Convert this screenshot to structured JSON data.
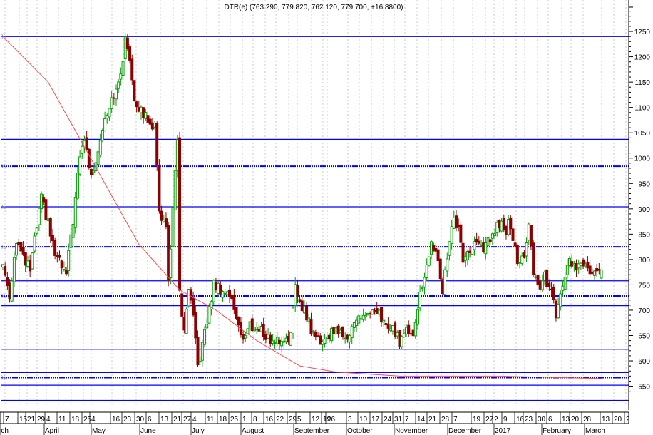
{
  "chart_data": {
    "type": "candlestick",
    "title": "DTR(e) (763.290, 779.820, 762.120, 779.700, +16.8800)",
    "ylim": [
      510,
      1312
    ],
    "y_ticks": [
      550,
      600,
      650,
      700,
      750,
      800,
      850,
      900,
      950,
      1000,
      1050,
      1100,
      1150,
      1200,
      1250
    ],
    "num_bars": 265,
    "close_anchors": [
      [
        0,
        790
      ],
      [
        3,
        730
      ],
      [
        6,
        840
      ],
      [
        9,
        800
      ],
      [
        12,
        780
      ],
      [
        17,
        920
      ],
      [
        20,
        870
      ],
      [
        23,
        810
      ],
      [
        28,
        770
      ],
      [
        31,
        880
      ],
      [
        34,
        1000
      ],
      [
        36,
        1040
      ],
      [
        39,
        960
      ],
      [
        42,
        1020
      ],
      [
        45,
        1080
      ],
      [
        48,
        1120
      ],
      [
        51,
        1140
      ],
      [
        54,
        1230
      ],
      [
        56,
        1200
      ],
      [
        58,
        1120
      ],
      [
        61,
        1090
      ],
      [
        64,
        1080
      ],
      [
        67,
        1060
      ],
      [
        69,
        900
      ],
      [
        72,
        860
      ],
      [
        73,
        760
      ],
      [
        75,
        900
      ],
      [
        77,
        1030
      ],
      [
        78,
        740
      ],
      [
        80,
        650
      ],
      [
        82,
        740
      ],
      [
        84,
        680
      ],
      [
        86,
        590
      ],
      [
        88,
        630
      ],
      [
        91,
        700
      ],
      [
        93,
        750
      ],
      [
        97,
        740
      ],
      [
        100,
        730
      ],
      [
        103,
        690
      ],
      [
        106,
        640
      ],
      [
        109,
        670
      ],
      [
        114,
        660
      ],
      [
        118,
        640
      ],
      [
        122,
        640
      ],
      [
        127,
        650
      ],
      [
        129,
        740
      ],
      [
        131,
        720
      ],
      [
        134,
        690
      ],
      [
        137,
        650
      ],
      [
        141,
        640
      ],
      [
        144,
        650
      ],
      [
        147,
        670
      ],
      [
        150,
        640
      ],
      [
        153,
        660
      ],
      [
        156,
        680
      ],
      [
        159,
        690
      ],
      [
        162,
        690
      ],
      [
        166,
        690
      ],
      [
        169,
        670
      ],
      [
        172,
        660
      ],
      [
        175,
        640
      ],
      [
        178,
        660
      ],
      [
        181,
        660
      ],
      [
        184,
        730
      ],
      [
        188,
        800
      ],
      [
        189,
        840
      ],
      [
        191,
        810
      ],
      [
        194,
        740
      ],
      [
        196,
        810
      ],
      [
        199,
        880
      ],
      [
        201,
        860
      ],
      [
        203,
        800
      ],
      [
        206,
        820
      ],
      [
        209,
        830
      ],
      [
        212,
        820
      ],
      [
        216,
        850
      ],
      [
        219,
        870
      ],
      [
        222,
        860
      ],
      [
        223,
        890
      ],
      [
        227,
        800
      ],
      [
        230,
        800
      ],
      [
        232,
        860
      ],
      [
        234,
        780
      ],
      [
        237,
        740
      ],
      [
        239,
        770
      ],
      [
        242,
        730
      ],
      [
        244,
        690
      ],
      [
        247,
        740
      ],
      [
        250,
        800
      ],
      [
        253,
        780
      ],
      [
        256,
        790
      ],
      [
        259,
        770
      ],
      [
        264,
        780
      ]
    ],
    "last_bar": {
      "open": 763.29,
      "high": 779.82,
      "low": 762.12,
      "close": 779.7
    },
    "moving_average": [
      [
        0,
        1240
      ],
      [
        20,
        1150
      ],
      [
        40,
        990
      ],
      [
        60,
        830
      ],
      [
        78,
        740
      ],
      [
        94,
        700
      ],
      [
        112,
        640
      ],
      [
        131,
        590
      ],
      [
        147,
        578
      ],
      [
        175,
        570
      ],
      [
        219,
        570
      ],
      [
        264,
        565
      ]
    ],
    "horizontal_lines": [
      {
        "price": 1240,
        "style": "solid",
        "marker": "%"
      },
      {
        "price": 1037,
        "style": "solid"
      },
      {
        "price": 984,
        "style": "dotted",
        "marker": "%"
      },
      {
        "price": 904,
        "style": "solid",
        "marker": "%"
      },
      {
        "price": 825,
        "style": "dotted",
        "marker": "%"
      },
      {
        "price": 758,
        "style": "solid"
      },
      {
        "price": 728,
        "style": "dotted",
        "marker": "%"
      },
      {
        "price": 709,
        "style": "solid"
      },
      {
        "price": 623,
        "style": "solid"
      },
      {
        "price": 577,
        "style": "solid"
      },
      {
        "price": 567,
        "style": "dotted",
        "marker": "%"
      },
      {
        "price": 552,
        "style": "solid"
      },
      {
        "price": 522,
        "style": "solid"
      }
    ],
    "x_tick_labels": [
      "7",
      "15",
      "21",
      "29",
      "4",
      "11",
      "18",
      "25",
      "4",
      "16",
      "23",
      "30",
      "6",
      "13",
      "21",
      "27",
      "4",
      "11",
      "18",
      "25",
      "1",
      "8",
      "16",
      "22",
      "29",
      "5",
      "12",
      "19",
      "26",
      "3",
      "10",
      "17",
      "24",
      "31",
      "7",
      "14",
      "21",
      "28",
      "7",
      "19",
      "27",
      "2",
      "9",
      "16",
      "23",
      "30",
      "6",
      "13",
      "20",
      "28",
      "13",
      "20",
      "2"
    ],
    "month_labels": [
      "rch",
      "April",
      "May",
      "June",
      "July",
      "August",
      "September",
      "October",
      "November",
      "December",
      "2017",
      "February",
      "March"
    ],
    "colors": {
      "up": "#00a000",
      "down": "#8b0000",
      "level": "#0000ff",
      "ma": "#ff4a4a",
      "grid": "#c8c8c8"
    }
  }
}
